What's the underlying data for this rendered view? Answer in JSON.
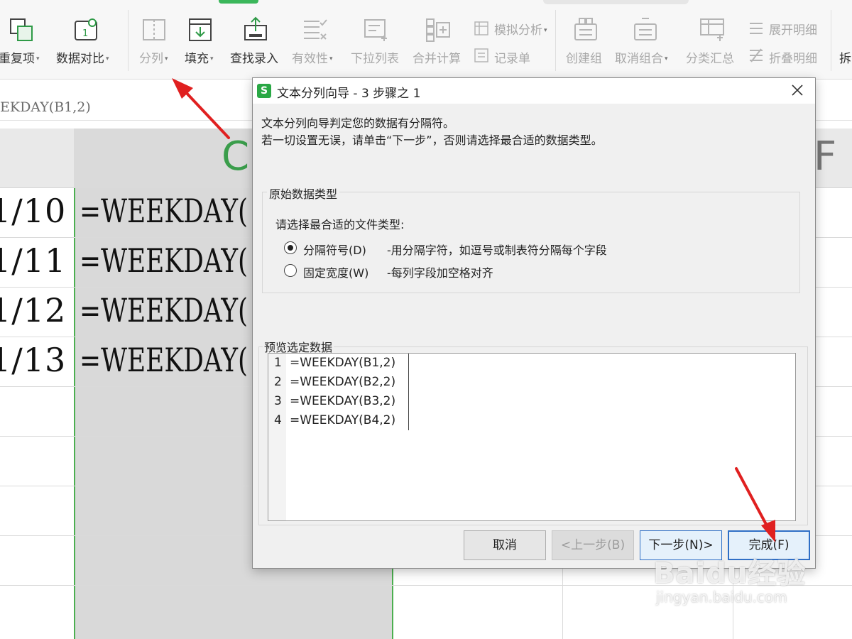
{
  "toolbar": {
    "items": [
      {
        "label": "重复项",
        "caret": "▾",
        "icon": "duplicate-icon",
        "enabled": true
      },
      {
        "label": "数据对比",
        "caret": "▾",
        "icon": "data-compare-icon",
        "enabled": true
      },
      {
        "label": "分列",
        "caret": "▾",
        "icon": "split-columns-icon",
        "enabled": false
      },
      {
        "label": "填充",
        "caret": "▾",
        "icon": "fill-down-icon",
        "enabled": true
      },
      {
        "label": "查找录入",
        "caret": "",
        "icon": "lookup-entry-icon",
        "enabled": true
      },
      {
        "label": "有效性",
        "caret": "▾",
        "icon": "validity-icon",
        "enabled": false
      },
      {
        "label": "下拉列表",
        "caret": "",
        "icon": "dropdown-list-icon",
        "enabled": false
      },
      {
        "label": "合并计算",
        "caret": "",
        "icon": "consolidate-icon",
        "enabled": false
      },
      {
        "label": "模拟分析",
        "caret": "▾",
        "icon": "what-if-icon",
        "enabled": false
      },
      {
        "label": "记录单",
        "caret": "",
        "icon": "record-form-icon",
        "enabled": false
      },
      {
        "label": "创建组",
        "caret": "",
        "icon": "create-group-icon",
        "enabled": false
      },
      {
        "label": "取消组合",
        "caret": "▾",
        "icon": "ungroup-icon",
        "enabled": false
      },
      {
        "label": "分类汇总",
        "caret": "",
        "icon": "subtotal-icon",
        "enabled": false
      },
      {
        "label": "展开明细",
        "caret": "",
        "icon": "expand-detail-icon",
        "enabled": false
      },
      {
        "label": "折叠明细",
        "caret": "",
        "icon": "collapse-detail-icon",
        "enabled": false
      },
      {
        "label": "拆",
        "caret": "",
        "icon": "",
        "enabled": true
      }
    ]
  },
  "formula_bar": {
    "text": "EKDAY(B1,2)"
  },
  "sheet": {
    "column_c_letter": "C",
    "column_f_letter": "F",
    "rows": [
      {
        "date": "1/10",
        "formula": "=WEEKDAY("
      },
      {
        "date": "1/11",
        "formula": "=WEEKDAY("
      },
      {
        "date": "1/12",
        "formula": "=WEEKDAY("
      },
      {
        "date": "1/13",
        "formula": "=WEEKDAY("
      }
    ]
  },
  "dialog": {
    "app_icon_letter": "S",
    "title": "文本分列向导 - 3 步骤之 1",
    "intro_line1": "文本分列向导判定您的数据有分隔符。",
    "intro_line2": "若一切设置无误，请单击“下一步”，否则请选择最合适的数据类型。",
    "group_title": "原始数据类型",
    "prompt": "请选择最合适的文件类型:",
    "options": [
      {
        "label": "分隔符号(D)",
        "desc": "-用分隔字符，如逗号或制表符分隔每个字段",
        "checked": true
      },
      {
        "label": "固定宽度(W)",
        "desc": "-每列字段加空格对齐",
        "checked": false
      }
    ],
    "preview_title": "预览选定数据",
    "preview_lines": [
      {
        "num": "1",
        "text": "=WEEKDAY(B1,2)"
      },
      {
        "num": "2",
        "text": "=WEEKDAY(B2,2)"
      },
      {
        "num": "3",
        "text": "=WEEKDAY(B3,2)"
      },
      {
        "num": "4",
        "text": "=WEEKDAY(B4,2)"
      }
    ],
    "buttons": {
      "cancel": "取消",
      "back": "<上一步(B)",
      "next": "下一步(N)>",
      "finish": "完成(F)"
    }
  },
  "watermark": {
    "logo": "Baidu经验",
    "url": "jingyan.baidu.com"
  },
  "colors": {
    "accent_green": "#3bb75b",
    "arrow_red": "#e02020",
    "selection_border": "#4caf50",
    "button_focus": "#2f6fc6"
  }
}
